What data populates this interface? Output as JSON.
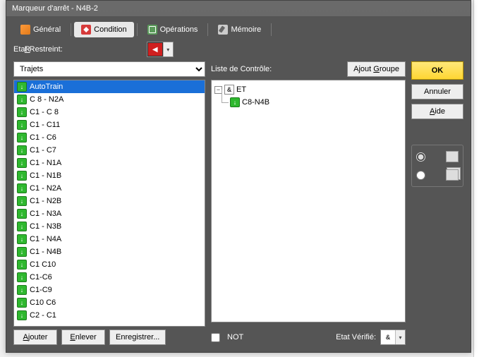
{
  "window": {
    "title": "Marqueur d'arrêt - N4B-2"
  },
  "tabs": [
    {
      "label": "Général"
    },
    {
      "label": "Condition"
    },
    {
      "label": "Opérations"
    },
    {
      "label": "Mémoire"
    }
  ],
  "activeTab": 1,
  "restricted": {
    "label": "Etat Restreint:"
  },
  "leftCombo": {
    "value": "Trajets",
    "options": [
      "Trajets"
    ]
  },
  "listItems": [
    "AutoTrain",
    "C 8 - N2A",
    "C1 - C 8",
    "C1 - C11",
    "C1 - C6",
    "C1 - C7",
    "C1 - N1A",
    "C1 - N1B",
    "C1 - N2A",
    "C1 - N2B",
    "C1 - N3A",
    "C1 - N3B",
    "C1 - N4A",
    "C1 - N4B",
    "C1 C10",
    "C1-C6",
    "C1-C9",
    "C10 C6",
    "C2 - C1"
  ],
  "listSelectedIndex": 0,
  "leftButtons": {
    "add": "Ajouter",
    "remove": "Enlever",
    "save": "Enregistrer..."
  },
  "mid": {
    "header": "Liste de Contrôle:",
    "groupBtn": "Ajout Groupe",
    "tree": {
      "root": {
        "op": "&",
        "label": "ET"
      },
      "child": {
        "label": "C8-N4B"
      }
    },
    "notLabel": "NOT",
    "verifiedLabel": "Etat Vérifié:",
    "verifiedValue": "&"
  },
  "right": {
    "ok": "OK",
    "cancel": "Annuler",
    "help": "Aide"
  }
}
